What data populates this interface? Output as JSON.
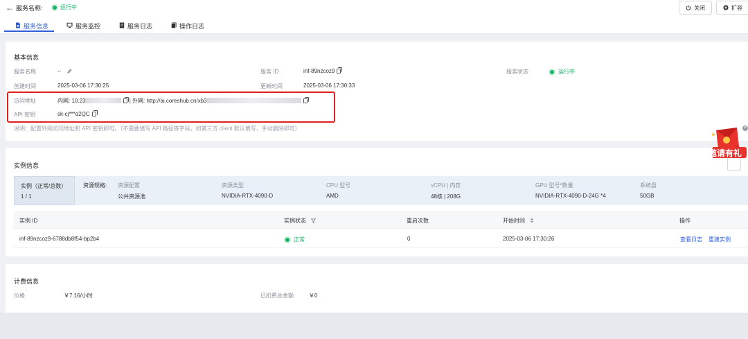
{
  "header": {
    "back_icon": "arrow-left-icon",
    "service_label": "服务名称:",
    "service_status": "运行中",
    "close_label": "关闭",
    "scale_label": "扩容",
    "tabs": [
      {
        "label": "服务信息",
        "icon": "document-icon",
        "active": true
      },
      {
        "label": "服务监控",
        "icon": "monitor-icon",
        "active": false
      },
      {
        "label": "服务日志",
        "icon": "log-icon",
        "active": false
      },
      {
        "label": "操作日志",
        "icon": "operation-log-icon",
        "active": false
      }
    ]
  },
  "basic": {
    "title": "基本信息",
    "name_label": "服务名称",
    "name_value": "--",
    "id_label": "服务 ID",
    "id_value": "inf-89nzcoz9",
    "status_label": "服务状态",
    "status_value": "运行中",
    "created_label": "创建时间",
    "created_value": "2025-03-06 17:30:25",
    "updated_label": "更新时间",
    "updated_value": "2025-03-06 17:30:33",
    "access_label": "访问地址",
    "access_internal": "内网: 10.23",
    "access_external": "| 外网: http://ai.coreshub.cn/xb3",
    "apikey_label": "API 密钥",
    "apikey_value": "sk-cj***d2QC",
    "note": "说明：配置外网访问地址和 API 密钥即可。（不需要填写 API 路径等字段，如第三方 client 默认填写，手动删除即可）"
  },
  "instances": {
    "title": "实例信息",
    "count_label": "实例（正常/总数）",
    "count_value": "1 / 1",
    "spec_label": "资源规格:",
    "specs": [
      {
        "label": "资源配置",
        "value": "公共资源池"
      },
      {
        "label": "资源类型",
        "value": "NVIDIA-RTX-4090-D"
      },
      {
        "label": "CPU 型号",
        "value": "AMD"
      },
      {
        "label": "vCPU | 内存",
        "value": "48核 | 208G"
      },
      {
        "label": "GPU 型号*数量",
        "value": "NVIDIA-RTX-4090-D-24G *4"
      },
      {
        "label": "系统盘",
        "value": "50GB"
      }
    ],
    "columns": [
      "实例 ID",
      "实例状态",
      "重启次数",
      "开始时间",
      "操作"
    ],
    "rows": [
      {
        "id": "inf-89nzcoz9-6788db8f54-bp2b4",
        "status": "正常",
        "restarts": "0",
        "start": "2025-03-06 17:30:26",
        "action_logs": "查看日志",
        "action_rebuild": "重建实例"
      }
    ]
  },
  "billing": {
    "title": "计费信息",
    "price_label": "价格",
    "price_value": "￥7.16/小时",
    "deducted_label": "已扣费总金额",
    "deducted_value": "￥0"
  },
  "promo": {
    "text": "邀请有礼"
  },
  "colors": {
    "accent": "#2f5fd8",
    "success": "#1bb36b",
    "highlight": "#e0221e"
  }
}
